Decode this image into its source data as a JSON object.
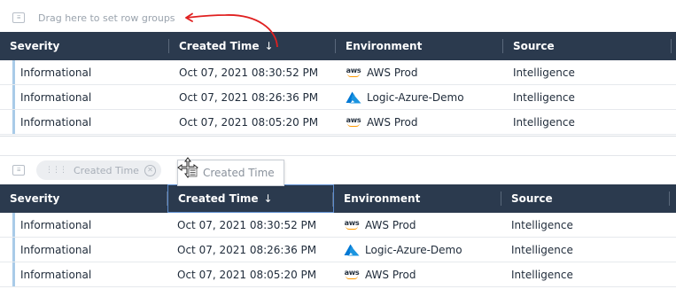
{
  "top_panel": {
    "group_bar": {
      "placeholder": "Drag here to set row groups"
    },
    "columns": [
      {
        "label": "Severity"
      },
      {
        "label": "Created Time",
        "sort": "↓"
      },
      {
        "label": "Environment"
      },
      {
        "label": "Source"
      }
    ],
    "rows": [
      {
        "severity": "Informational",
        "created_time": "Oct 07, 2021 08:30:52 PM",
        "environment": "AWS Prod",
        "env_icon": "aws-icon",
        "source": "Intelligence"
      },
      {
        "severity": "Informational",
        "created_time": "Oct 07, 2021 08:26:36 PM",
        "environment": "Logic-Azure-Demo",
        "env_icon": "azure-icon",
        "source": "Intelligence"
      },
      {
        "severity": "Informational",
        "created_time": "Oct 07, 2021 08:05:20 PM",
        "environment": "AWS Prod",
        "env_icon": "aws-icon",
        "source": "Intelligence"
      }
    ]
  },
  "bottom_panel": {
    "group_bar": {
      "chip_label": "Created Time",
      "chip_remove": "⊗"
    },
    "drag_ghost": {
      "label": "Created Time"
    },
    "columns": [
      {
        "label": "Severity"
      },
      {
        "label": "Created Time",
        "sort": "↓"
      },
      {
        "label": "Environment"
      },
      {
        "label": "Source"
      }
    ],
    "rows": [
      {
        "severity": "Informational",
        "created_time": "Oct 07, 2021 08:30:52 PM",
        "environment": "AWS Prod",
        "env_icon": "aws-icon",
        "source": "Intelligence"
      },
      {
        "severity": "Informational",
        "created_time": "Oct 07, 2021 08:26:36 PM",
        "environment": "Logic-Azure-Demo",
        "env_icon": "azure-icon",
        "source": "Intelligence"
      },
      {
        "severity": "Informational",
        "created_time": "Oct 07, 2021 08:05:20 PM",
        "environment": "AWS Prod",
        "env_icon": "aws-icon",
        "source": "Intelligence"
      }
    ]
  },
  "icons": {
    "aws_label": "aws"
  },
  "colors": {
    "header_bg": "#2b3a4e",
    "row_accent": "#a9cbe8",
    "annotation_arrow": "#e02020",
    "aws_orange": "#ff9900",
    "azure_blue": "#0078d4"
  }
}
